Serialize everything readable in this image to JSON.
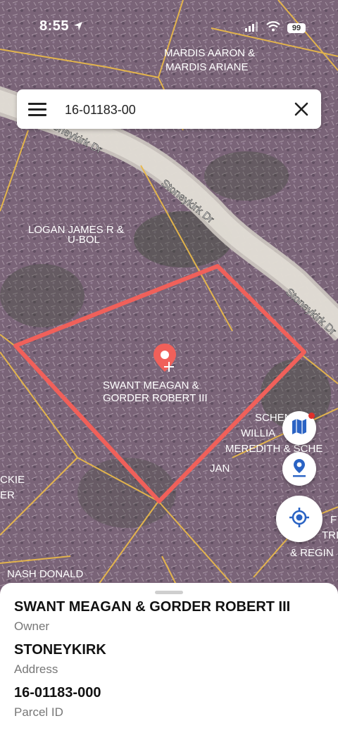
{
  "status_bar": {
    "time": "8:55",
    "battery": "99"
  },
  "search": {
    "value": "16-01183-00"
  },
  "map": {
    "street_label": "Stoneykirk Dr",
    "parcel_labels": [
      {
        "line1": "MARDIS AARON &",
        "line2": "MARDIS ARIANE"
      },
      {
        "line1": "LOGAN JAMES R &",
        "line2": "U-BOL"
      },
      {
        "line1": "SWANT MEAGAN &",
        "line2": "GORDER ROBERT III"
      },
      {
        "line1": "SCHENK",
        "line2": "WILLIA"
      },
      {
        "line1": "MEREDITH & SCHE",
        "line2": "JAN"
      },
      {
        "line1": "CKIE",
        "line2": "ER"
      },
      {
        "line1": "F",
        "line2": "TRI"
      },
      {
        "line1": "& REGIN",
        "line2": ""
      },
      {
        "line1": "NASH DONALD",
        "line2": ""
      }
    ],
    "selection_color": "#f0605a"
  },
  "details": {
    "owner_value": "SWANT MEAGAN & GORDER ROBERT III",
    "owner_label": "Owner",
    "address_value": "STONEYKIRK",
    "address_label": "Address",
    "parcel_value": "16-01183-000",
    "parcel_label": "Parcel ID"
  }
}
